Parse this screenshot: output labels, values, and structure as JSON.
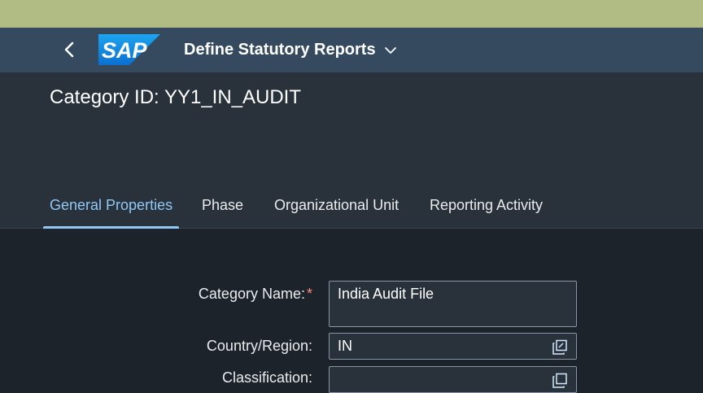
{
  "shell": {
    "logo_text": "SAP",
    "app_title": "Define Statutory Reports",
    "colors": {
      "topstrip": "#b1bc84",
      "shellbar": "#354a5f",
      "accent": "#91c8f6"
    }
  },
  "header": {
    "title": "Category ID: YY1_IN_AUDIT",
    "tabs": [
      {
        "label": "General Properties",
        "active": true
      },
      {
        "label": "Phase"
      },
      {
        "label": "Organizational Unit"
      },
      {
        "label": "Reporting Activity"
      }
    ]
  },
  "form": {
    "category_name": {
      "label": "Category Name:",
      "required_mark": "*",
      "value": "India Audit File"
    },
    "country_region": {
      "label": "Country/Region:",
      "value": "IN"
    },
    "classification": {
      "label": "Classification:",
      "value": ""
    }
  }
}
